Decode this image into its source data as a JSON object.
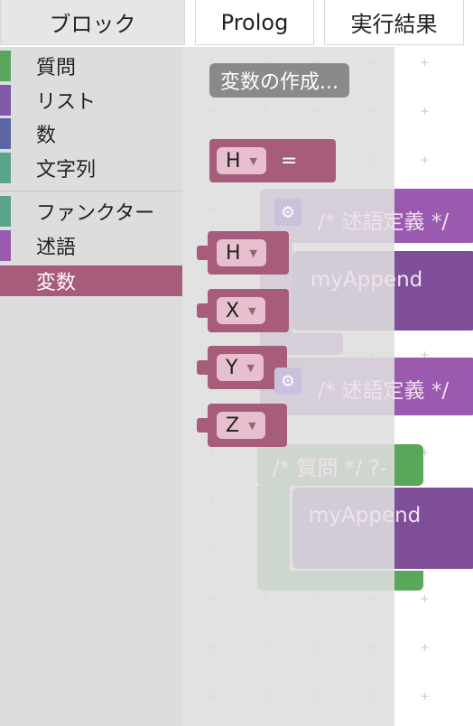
{
  "tabs": [
    {
      "label": "ブロック",
      "active": true
    },
    {
      "label": "Prolog",
      "active": false
    },
    {
      "label": "実行結果",
      "active": false
    }
  ],
  "toolbox": {
    "categories": [
      {
        "label": "質問",
        "color": "#5ba65c"
      },
      {
        "label": "リスト",
        "color": "#7e5aa8"
      },
      {
        "label": "数",
        "color": "#5b67a5"
      },
      {
        "label": "文字列",
        "color": "#5aa58a"
      },
      {
        "label": "ファンクター",
        "color": "#5aa58a"
      },
      {
        "label": "述語",
        "color": "#9a5ab0"
      },
      {
        "label": "変数",
        "color": "#a65c7a",
        "selected": true
      }
    ]
  },
  "flyout": {
    "create_button": "変数の作成...",
    "assign_block": {
      "var": "H",
      "op": "="
    },
    "variables": [
      "H",
      "X",
      "Y",
      "Z"
    ]
  },
  "workspace": {
    "predicate_comment": "/* 述語定義 */",
    "predicate_name": "myAppend",
    "query_comment": "/* 質問 */ ?-",
    "query_name": "myAppend"
  },
  "colors": {
    "variable": "#a65c7a",
    "predicate": "#9a5ab0",
    "query": "#5aa65b"
  }
}
